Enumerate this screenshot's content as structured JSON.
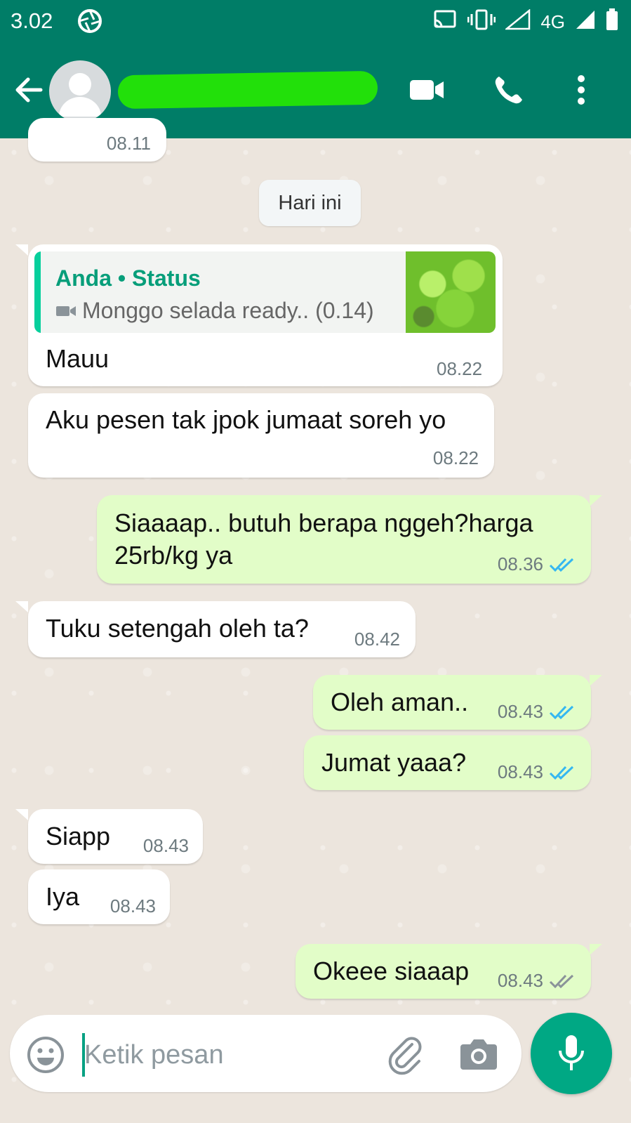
{
  "status_bar": {
    "time": "3.02",
    "network": "4G"
  },
  "header": {
    "contact_name": ""
  },
  "date_chip": "Hari ini",
  "partial_top": {
    "time": "08.11"
  },
  "quoted_message": {
    "author": "Anda • Status",
    "text": "Monggo selada ready.. (0.14)",
    "reply": "Mauu",
    "time": "08.22"
  },
  "messages": [
    {
      "dir": "in",
      "text": "Aku pesen tak jpok jumaat soreh yo",
      "time": "08.22"
    },
    {
      "dir": "out",
      "text": "Siaaaap.. butuh berapa nggeh?harga 25rb/kg ya",
      "time": "08.36",
      "status": "read"
    },
    {
      "dir": "in",
      "text": "Tuku setengah oleh ta?",
      "time": "08.42"
    },
    {
      "dir": "out",
      "text": "Oleh aman..",
      "time": "08.43",
      "status": "read"
    },
    {
      "dir": "out",
      "text": "Jumat yaaa?",
      "time": "08.43",
      "status": "read"
    },
    {
      "dir": "in",
      "text": "Siapp",
      "time": "08.43"
    },
    {
      "dir": "in",
      "text": "Iya",
      "time": "08.43"
    },
    {
      "dir": "out",
      "text": "Okeee siaaap",
      "time": "08.43",
      "status": "delivered"
    }
  ],
  "composer": {
    "placeholder": "Ketik pesan",
    "value": ""
  },
  "colors": {
    "header": "#007d67",
    "read_tick": "#34b7f1",
    "delivered_tick": "#8a9399",
    "outgoing_bubble": "#e2fdc8",
    "accent": "#00a884"
  }
}
